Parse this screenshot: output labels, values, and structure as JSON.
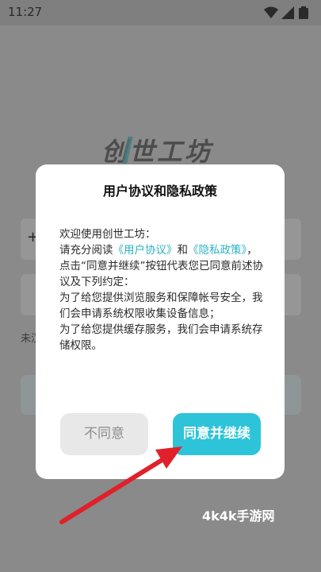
{
  "status_bar": {
    "time": "11:27",
    "icons": [
      "wifi-icon",
      "signal-icon",
      "battery-icon"
    ]
  },
  "background_app": {
    "logo_text": "创世工坊",
    "plus_glyph": "+",
    "partial_text": "未汉"
  },
  "dialog": {
    "title": "用户协议和隐私政策",
    "intro": "欢迎使用创世工坊：",
    "line2_prefix": "请充分阅读",
    "link_user_agreement": "《用户协议》",
    "line2_and": "和",
    "link_privacy_policy": "《隐私政策》",
    "line2_suffix": "，点击“同意并继续”按钮代表您已同意前述协议及下列约定：",
    "clause1": "为了给您提供浏览服务和保障帐号安全，我们会申请系统权限收集设备信息；",
    "clause2": "为了给您提供缓存服务，我们会申请系统存储权限。",
    "disagree_label": "不同意",
    "agree_label": "同意并继续"
  },
  "watermark": "4k4k手游网",
  "colors": {
    "accent": "#2dc4d9",
    "link": "#2bb3c4",
    "overlay": "#8a8a8a",
    "arrow": "#e0202a"
  }
}
